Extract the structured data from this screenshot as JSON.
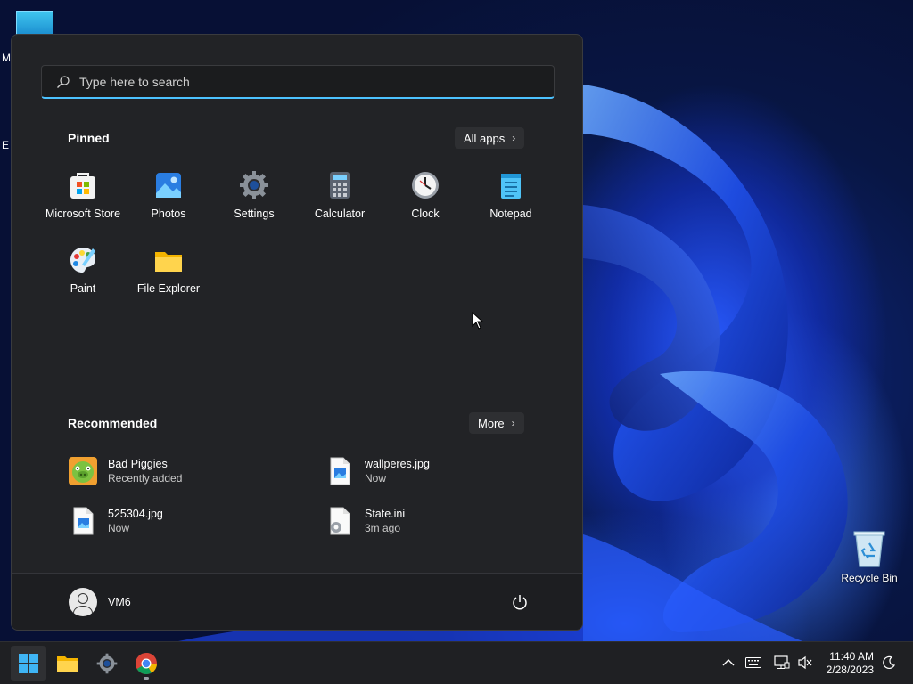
{
  "desktop": {
    "edge_labels": [
      "M",
      "E"
    ],
    "recycle_bin_label": "Recycle Bin"
  },
  "start_menu": {
    "search_placeholder": "Type here to search",
    "pinned": {
      "title": "Pinned",
      "all_apps_label": "All apps",
      "apps": [
        {
          "name": "Microsoft Store",
          "icon": "microsoft-store-icon"
        },
        {
          "name": "Photos",
          "icon": "photos-icon"
        },
        {
          "name": "Settings",
          "icon": "settings-gear-icon"
        },
        {
          "name": "Calculator",
          "icon": "calculator-icon"
        },
        {
          "name": "Clock",
          "icon": "clock-icon"
        },
        {
          "name": "Notepad",
          "icon": "notepad-icon"
        },
        {
          "name": "Paint",
          "icon": "paint-icon"
        },
        {
          "name": "File Explorer",
          "icon": "file-explorer-icon"
        }
      ]
    },
    "recommended": {
      "title": "Recommended",
      "more_label": "More",
      "items": [
        {
          "name": "Bad Piggies",
          "sub": "Recently added",
          "icon": "bad-piggies-icon"
        },
        {
          "name": "wallperes.jpg",
          "sub": "Now",
          "icon": "image-file-icon"
        },
        {
          "name": "525304.jpg",
          "sub": "Now",
          "icon": "image-file-icon"
        },
        {
          "name": "State.ini",
          "sub": "3m ago",
          "icon": "settings-file-icon"
        }
      ]
    },
    "user": {
      "name": "VM6"
    }
  },
  "taskbar": {
    "apps": [
      "start-icon",
      "file-explorer-icon",
      "settings-icon",
      "chrome-icon"
    ],
    "time": "11:40 AM",
    "date": "2/28/2023"
  },
  "colors": {
    "accent": "#4cc2ff",
    "menu_bg": "#222326",
    "taskbar_bg": "#1f2023"
  }
}
